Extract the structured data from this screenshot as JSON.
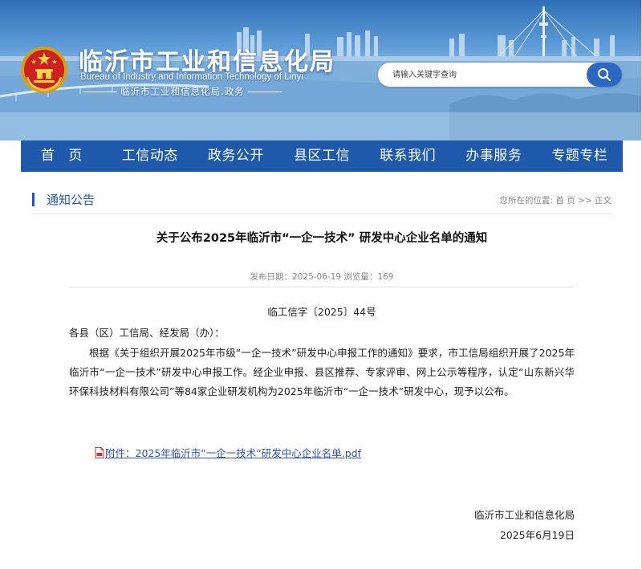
{
  "header": {
    "title": "临沂市工业和信息化局",
    "subtitle_en": "Bureau of Industry and Information Technology of Linyi",
    "subtitle_cn": "临沂市工业和信息化局.政务",
    "emblem_icon": "national-emblem-icon"
  },
  "search": {
    "placeholder": "请输入关键字查询",
    "button_icon": "search-icon"
  },
  "nav": {
    "items": [
      "首 页",
      "工信动态",
      "政务公开",
      "县区工信",
      "联系我们",
      "办事服务",
      "专题专栏"
    ]
  },
  "section": {
    "title": "通知公告",
    "breadcrumb_prefix": "您所在的位置:",
    "breadcrumb_home": "首 页",
    "breadcrumb_sep": ">>",
    "breadcrumb_current": "正文"
  },
  "article": {
    "title": "关于公布2025年临沂市“一企一技术” 研发中心企业名单的通知",
    "meta": "发布日期：2025-06-19 浏览量：169",
    "doc_number": "临工信字〔2025〕44号",
    "salutation": "各县（区）工信局、经发局（办）：",
    "body": "根据《关于组织开展2025年市级“一企一技术”研发中心申报工作的通知》要求，市工信局组织开展了2025年临沂市“一企一技术”研发中心申报工作。经企业申报、县区推荐、专家评审、网上公示等程序，认定“山东新兴华环保科技材料有限公司”等84家企业研发机构为2025年临沂市“一企一技术”研发中心，现予以公布。",
    "attachment": "附件：2025年临沂市“一企一技术”研发中心企业名单.pdf",
    "attachment_icon": "pdf-file-icon",
    "signature_org": "临沂市工业和信息化局",
    "signature_date": "2025年6月19日"
  },
  "colors": {
    "nav_bg": "#1f59ab",
    "accent": "#1f59ab",
    "link": "#2b52b4",
    "search_button": "#2d67c2"
  }
}
